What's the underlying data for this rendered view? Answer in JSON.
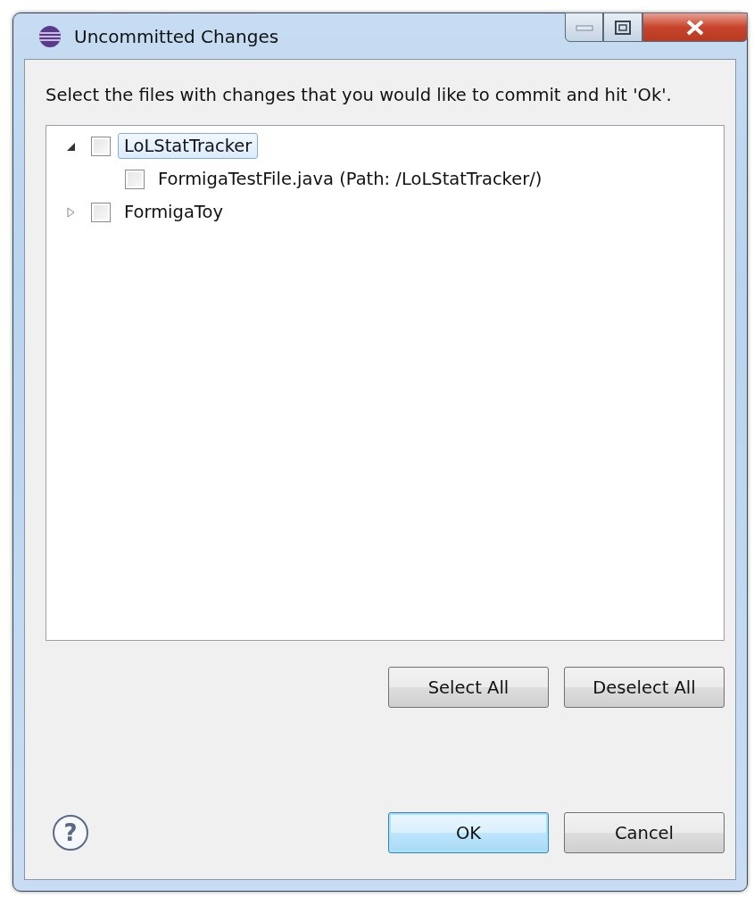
{
  "window": {
    "title": "Uncommitted Changes"
  },
  "instruction": "Select the files with changes that you would like to commit and hit 'Ok'.",
  "tree": [
    {
      "label": "LoLStatTracker",
      "expanded": true,
      "checked": false,
      "selected": true,
      "children": [
        {
          "label": "FormigaTestFile.java (Path: /LoLStatTracker/)",
          "checked": false,
          "selected": false
        }
      ]
    },
    {
      "label": "FormigaToy",
      "expanded": false,
      "checked": false,
      "selected": false
    }
  ],
  "selection_buttons": [
    {
      "label": "Select All",
      "default": false
    },
    {
      "label": "Deselect All",
      "default": false
    }
  ],
  "help": "?",
  "dialog_buttons": [
    {
      "label": "OK",
      "default": true
    },
    {
      "label": "Cancel",
      "default": false
    }
  ]
}
